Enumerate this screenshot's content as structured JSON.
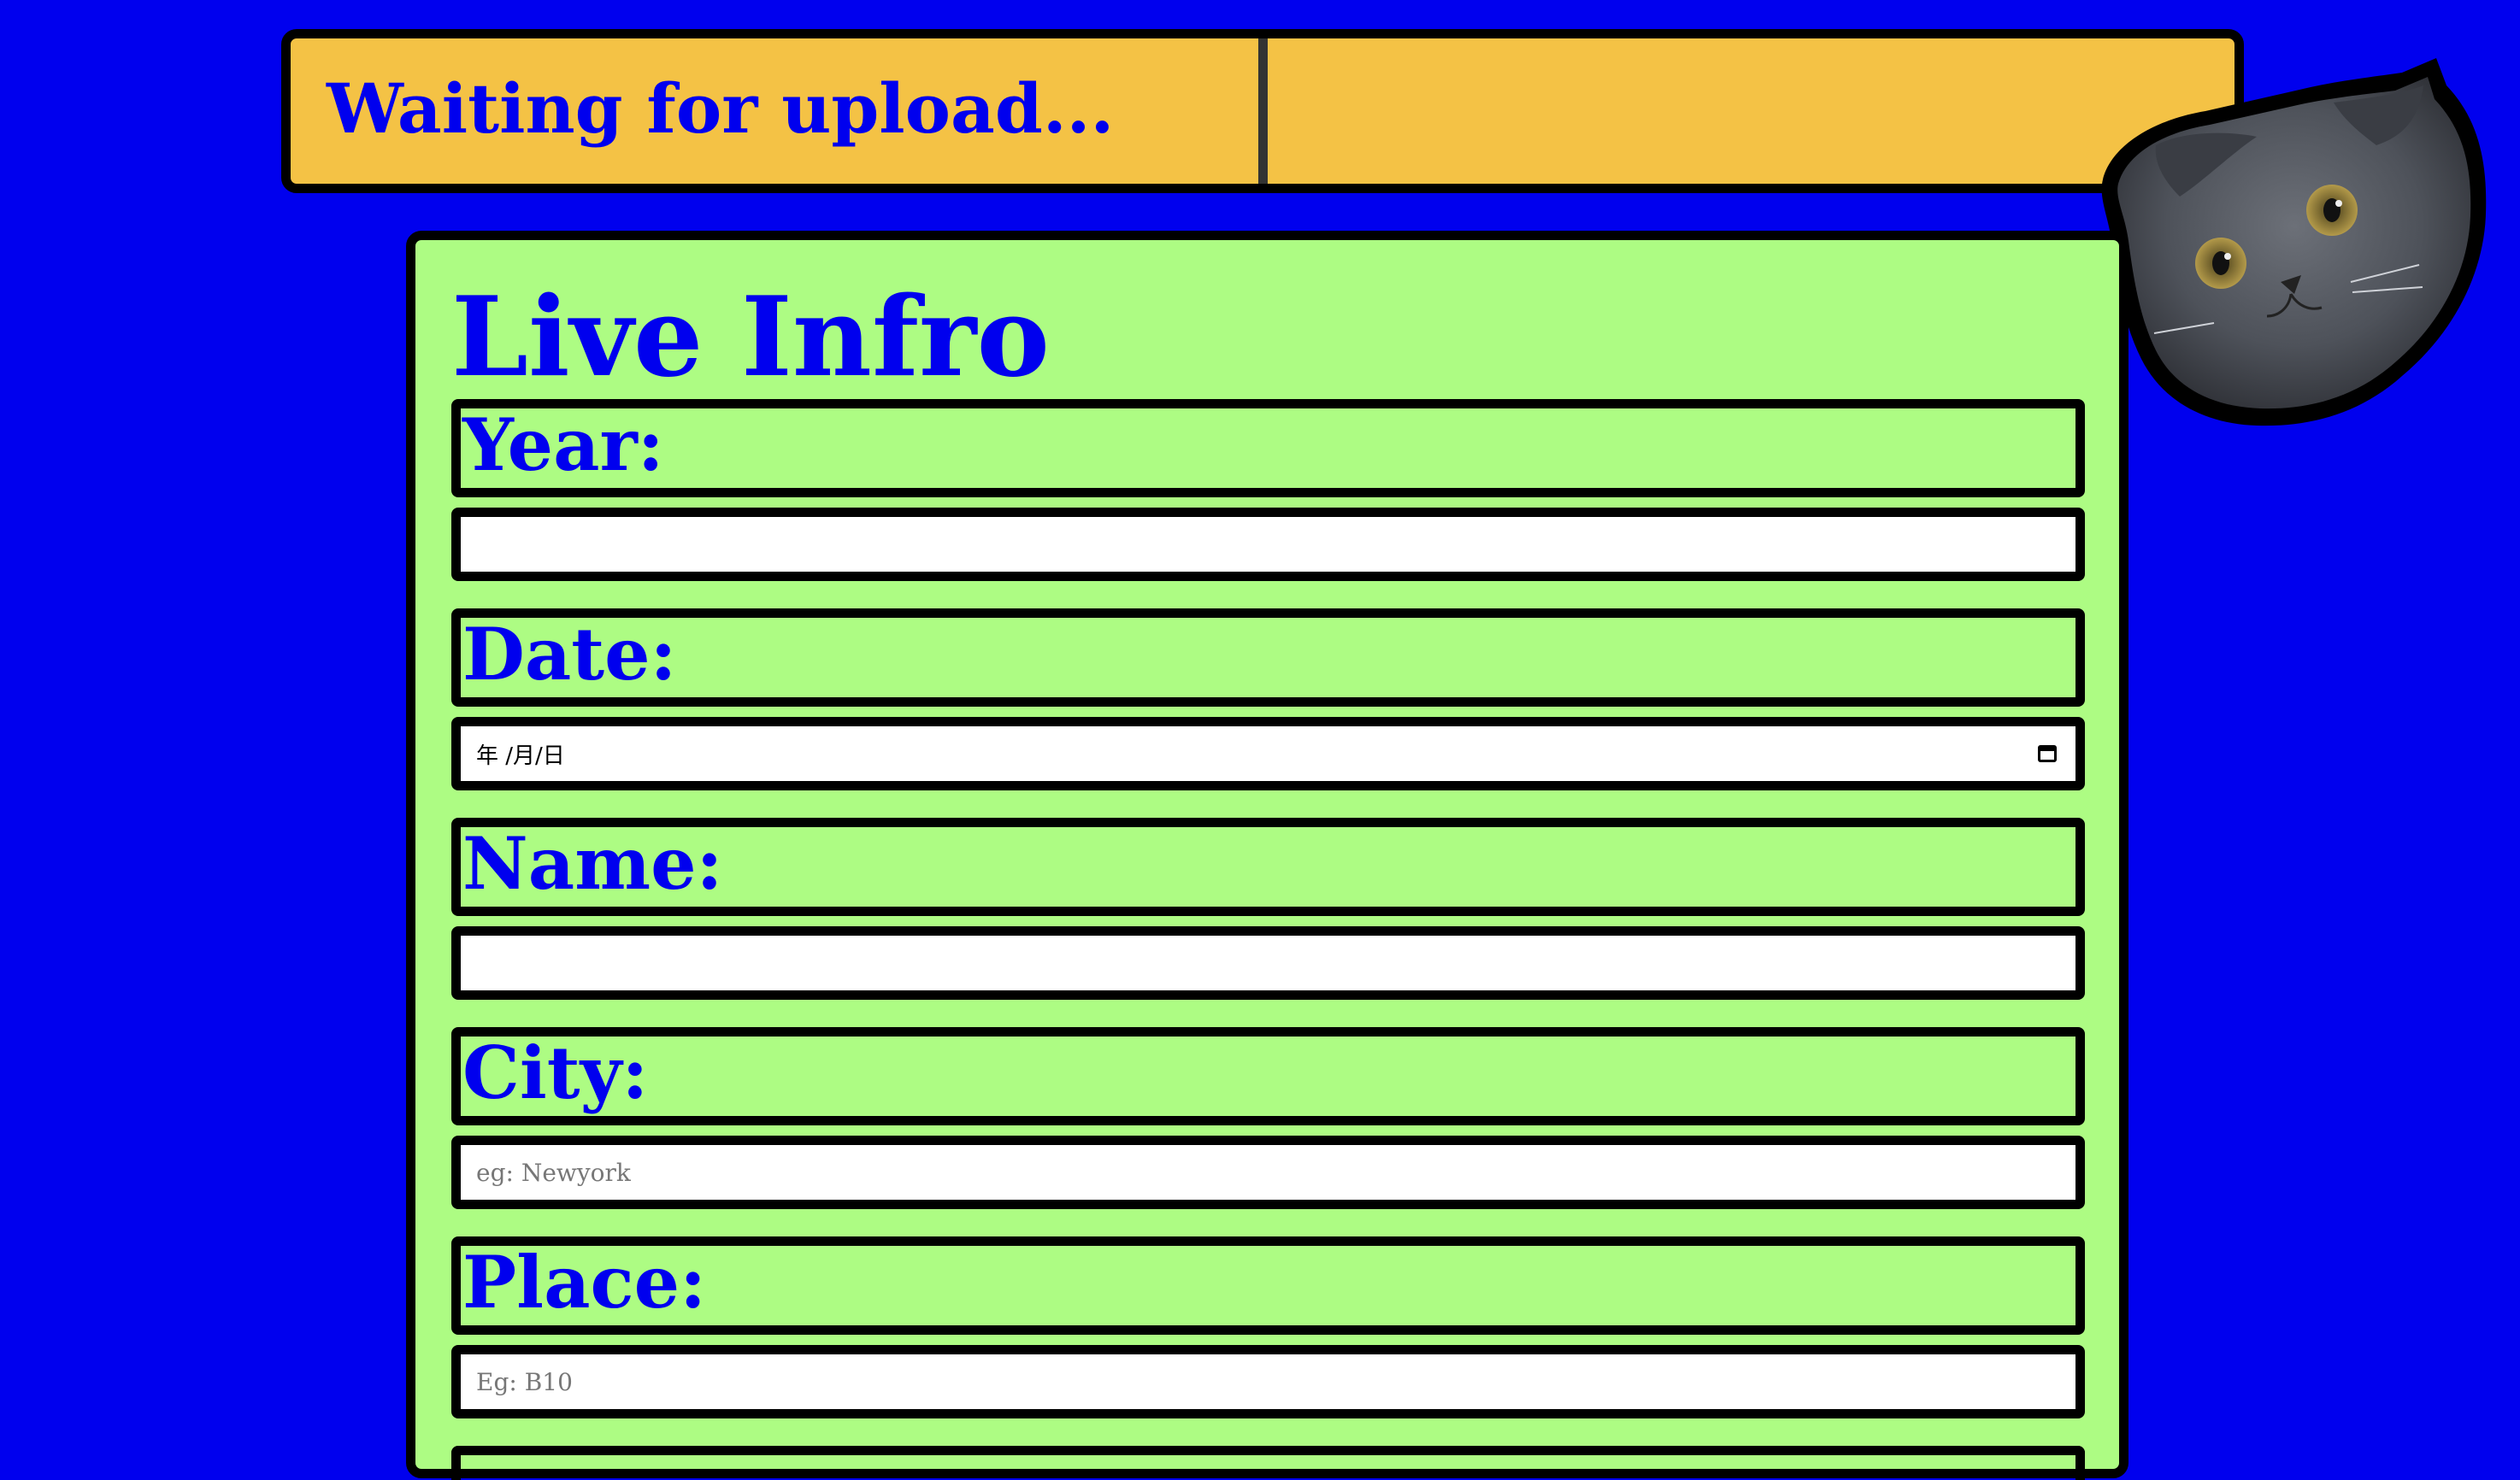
{
  "status": {
    "left_text": "Waiting for upload...",
    "right_text": ""
  },
  "panel": {
    "title": "Live Infro",
    "fields": [
      {
        "label": "Year:",
        "value": "",
        "placeholder": ""
      },
      {
        "label": "Date:",
        "value": "年 /月/日",
        "placeholder": ""
      },
      {
        "label": "Name:",
        "value": "",
        "placeholder": ""
      },
      {
        "label": "City:",
        "value": "",
        "placeholder": "eg: Newyork"
      },
      {
        "label": "Place:",
        "value": "",
        "placeholder": "Eg: B10"
      }
    ]
  },
  "colors": {
    "background": "#0000ee",
    "status_bar": "#f4c245",
    "panel": "#adfc83",
    "text": "#0000ee"
  },
  "icons": {
    "date_picker": "calendar-icon",
    "mascot": "cat-avatar"
  }
}
